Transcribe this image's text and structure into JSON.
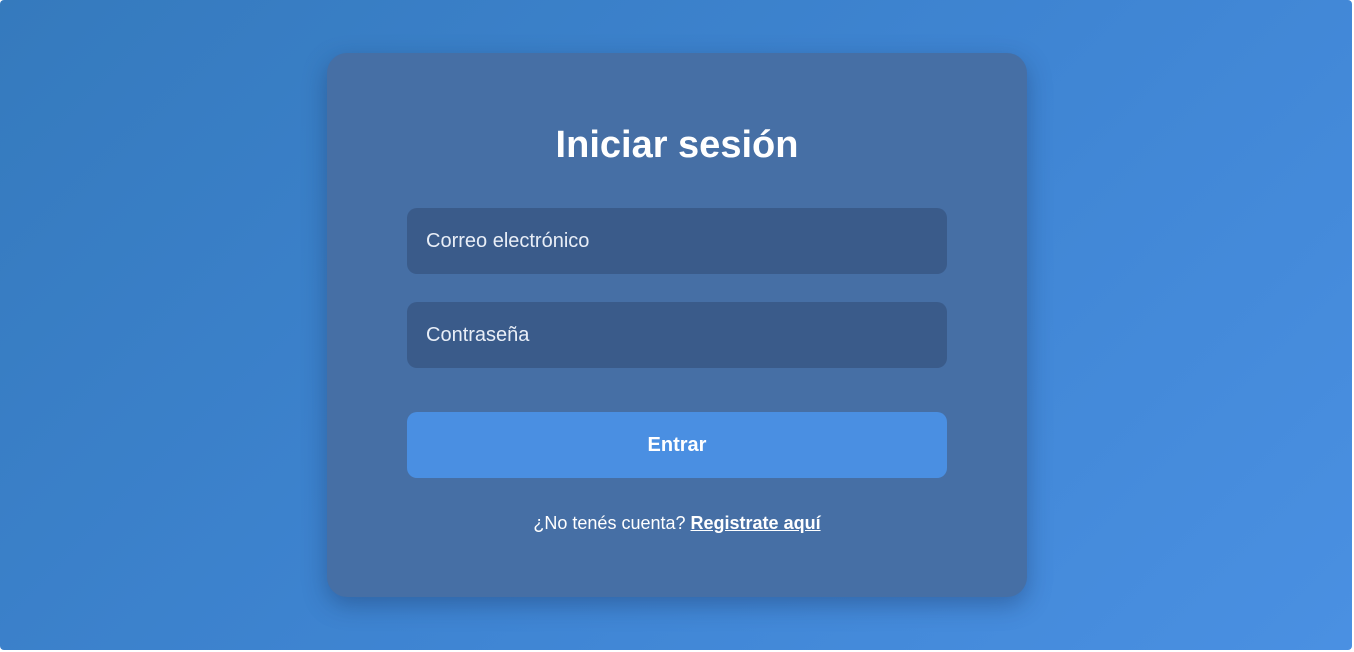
{
  "login": {
    "title": "Iniciar sesión",
    "email_placeholder": "Correo electrónico",
    "email_value": "",
    "password_placeholder": "Contraseña",
    "password_value": "",
    "submit_label": "Entrar",
    "register_prompt": "¿No tenés cuenta?",
    "register_link": "Registrate aquí"
  },
  "colors": {
    "background_start": "#357abd",
    "background_end": "#4a90e2",
    "card": "#466fa5",
    "input": "#3a5b8a",
    "button": "#4a8fe2",
    "text": "#ffffff"
  }
}
